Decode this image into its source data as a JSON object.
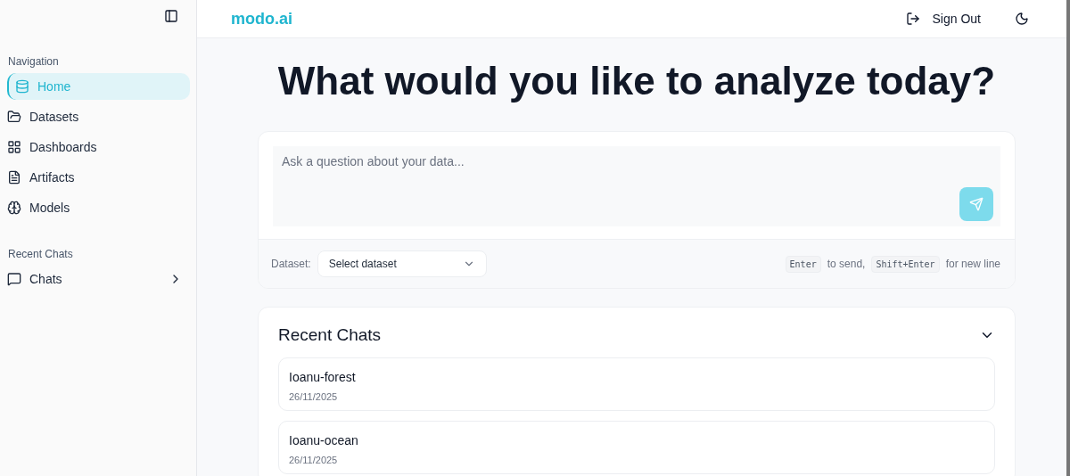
{
  "sidebar": {
    "sections": [
      {
        "heading": "Navigation",
        "items": [
          {
            "label": "Home",
            "selected": true
          },
          {
            "label": "Datasets",
            "selected": false
          },
          {
            "label": "Dashboards",
            "selected": false
          },
          {
            "label": "Artifacts",
            "selected": false
          },
          {
            "label": "Models",
            "selected": false
          }
        ]
      },
      {
        "heading": "Recent Chats",
        "items": [
          {
            "label": "Chats",
            "selected": false,
            "expandable": true
          }
        ]
      }
    ]
  },
  "header": {
    "logo": "modo.ai",
    "sign_out": "Sign Out"
  },
  "headline": "What would you like to analyze today?",
  "composer": {
    "placeholder": "Ask a question about your data...",
    "dataset_label": "Dataset:",
    "dataset_select": "Select dataset",
    "hint": [
      {
        "kind": "key",
        "text": "Enter"
      },
      {
        "kind": "text",
        "text": "to send,"
      },
      {
        "kind": "key",
        "text": "Shift+Enter"
      },
      {
        "kind": "text",
        "text": "for new line"
      }
    ]
  },
  "recent": {
    "title": "Recent Chats",
    "expanded": true,
    "chats": [
      {
        "name": "Ioanu-forest",
        "date": "26/11/2025"
      },
      {
        "name": "Ioanu-ocean",
        "date": "26/11/2025"
      }
    ]
  }
}
